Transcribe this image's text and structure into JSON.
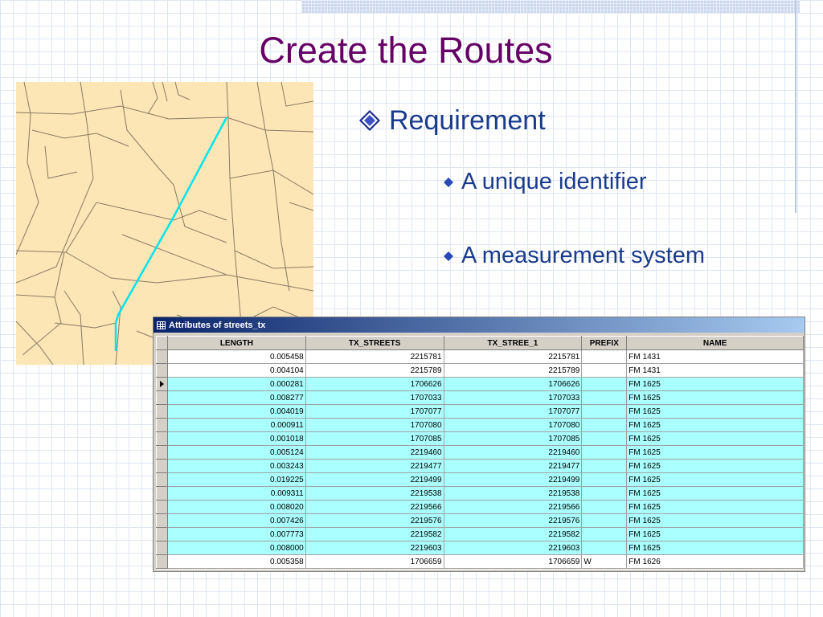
{
  "slide": {
    "title": "Create the Routes",
    "bullet": "Requirement",
    "subbullets": [
      "A unique identifier",
      "A measurement system"
    ]
  },
  "colors": {
    "title": "#660066",
    "bullet_text": "#1a3b8c",
    "map_background": "#fce6b6",
    "map_roads": "#8a7a60",
    "route_highlight": "#00e5ee",
    "row_highlight": "#aaffff"
  },
  "icons": {
    "bullet": "diamond-icon",
    "subbullet": "small-diamond-icon",
    "window": "table-icon",
    "current_row": "row-pointer-icon"
  },
  "window": {
    "title": "Attributes of streets_tx",
    "columns": [
      "LENGTH",
      "TX_STREETS",
      "TX_STREE_1",
      "PREFIX",
      "NAME"
    ],
    "rows": [
      {
        "length": "0.005458",
        "tx_streets": "2215781",
        "tx_stree_1": "2215781",
        "prefix": "",
        "name": "FM 1431",
        "highlighted": false,
        "current": false
      },
      {
        "length": "0.004104",
        "tx_streets": "2215789",
        "tx_stree_1": "2215789",
        "prefix": "",
        "name": "FM 1431",
        "highlighted": false,
        "current": false
      },
      {
        "length": "0.000281",
        "tx_streets": "1706626",
        "tx_stree_1": "1706626",
        "prefix": "",
        "name": "FM 1625",
        "highlighted": true,
        "current": true
      },
      {
        "length": "0.008277",
        "tx_streets": "1707033",
        "tx_stree_1": "1707033",
        "prefix": "",
        "name": "FM 1625",
        "highlighted": true,
        "current": false
      },
      {
        "length": "0.004019",
        "tx_streets": "1707077",
        "tx_stree_1": "1707077",
        "prefix": "",
        "name": "FM 1625",
        "highlighted": true,
        "current": false
      },
      {
        "length": "0.000911",
        "tx_streets": "1707080",
        "tx_stree_1": "1707080",
        "prefix": "",
        "name": "FM 1625",
        "highlighted": true,
        "current": false
      },
      {
        "length": "0.001018",
        "tx_streets": "1707085",
        "tx_stree_1": "1707085",
        "prefix": "",
        "name": "FM 1625",
        "highlighted": true,
        "current": false
      },
      {
        "length": "0.005124",
        "tx_streets": "2219460",
        "tx_stree_1": "2219460",
        "prefix": "",
        "name": "FM 1625",
        "highlighted": true,
        "current": false
      },
      {
        "length": "0.003243",
        "tx_streets": "2219477",
        "tx_stree_1": "2219477",
        "prefix": "",
        "name": "FM 1625",
        "highlighted": true,
        "current": false
      },
      {
        "length": "0.019225",
        "tx_streets": "2219499",
        "tx_stree_1": "2219499",
        "prefix": "",
        "name": "FM 1625",
        "highlighted": true,
        "current": false
      },
      {
        "length": "0.009311",
        "tx_streets": "2219538",
        "tx_stree_1": "2219538",
        "prefix": "",
        "name": "FM 1625",
        "highlighted": true,
        "current": false
      },
      {
        "length": "0.008020",
        "tx_streets": "2219566",
        "tx_stree_1": "2219566",
        "prefix": "",
        "name": "FM 1625",
        "highlighted": true,
        "current": false
      },
      {
        "length": "0.007426",
        "tx_streets": "2219576",
        "tx_stree_1": "2219576",
        "prefix": "",
        "name": "FM 1625",
        "highlighted": true,
        "current": false
      },
      {
        "length": "0.007773",
        "tx_streets": "2219582",
        "tx_stree_1": "2219582",
        "prefix": "",
        "name": "FM 1625",
        "highlighted": true,
        "current": false
      },
      {
        "length": "0.008000",
        "tx_streets": "2219603",
        "tx_stree_1": "2219603",
        "prefix": "",
        "name": "FM 1625",
        "highlighted": true,
        "current": false
      },
      {
        "length": "0.005358",
        "tx_streets": "1706659",
        "tx_stree_1": "1706659",
        "prefix": "W",
        "name": "FM 1626",
        "highlighted": false,
        "current": false
      }
    ]
  }
}
